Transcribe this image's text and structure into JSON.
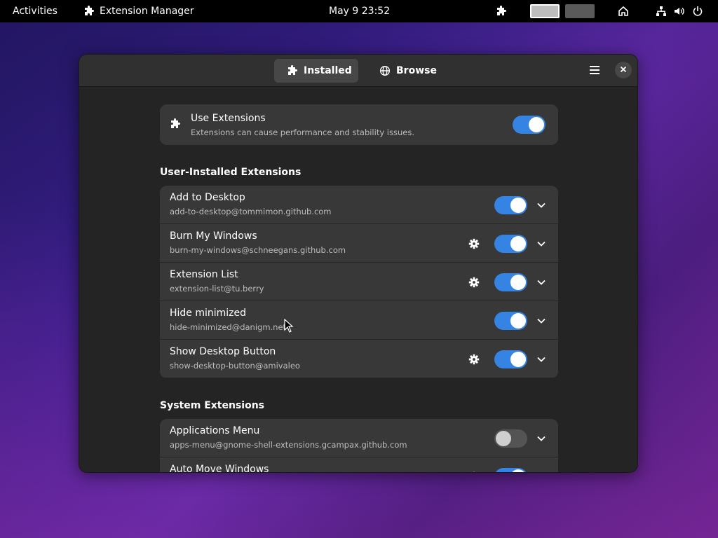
{
  "topbar": {
    "activities": "Activities",
    "app_name": "Extension Manager",
    "clock": "May 9  23:52"
  },
  "window": {
    "tabs": [
      {
        "label": "Installed",
        "icon": "puzzle-icon",
        "active": true
      },
      {
        "label": "Browse",
        "icon": "globe-icon",
        "active": false
      }
    ]
  },
  "use_extensions": {
    "title": "Use Extensions",
    "subtitle": "Extensions can cause performance and stability issues.",
    "enabled": true
  },
  "user_section_title": "User-Installed Extensions",
  "user_extensions": [
    {
      "name": "Add to Desktop",
      "uuid": "add-to-desktop@tommimon.github.com",
      "settings": false,
      "enabled": true
    },
    {
      "name": "Burn My Windows",
      "uuid": "burn-my-windows@schneegans.github.com",
      "settings": true,
      "enabled": true
    },
    {
      "name": "Extension List",
      "uuid": "extension-list@tu.berry",
      "settings": true,
      "enabled": true
    },
    {
      "name": "Hide minimized",
      "uuid": "hide-minimized@danigm.net",
      "settings": false,
      "enabled": true
    },
    {
      "name": "Show Desktop Button",
      "uuid": "show-desktop-button@amivaleo",
      "settings": true,
      "enabled": true
    }
  ],
  "system_section_title": "System Extensions",
  "system_extensions": [
    {
      "name": "Applications Menu",
      "uuid": "apps-menu@gnome-shell-extensions.gcampax.github.com",
      "settings": false,
      "enabled": false
    },
    {
      "name": "Auto Move Windows",
      "uuid": "",
      "settings": true,
      "enabled": true
    }
  ],
  "colors": {
    "accent": "#3584e4",
    "window_bg": "#242424",
    "card_bg": "#383838"
  }
}
